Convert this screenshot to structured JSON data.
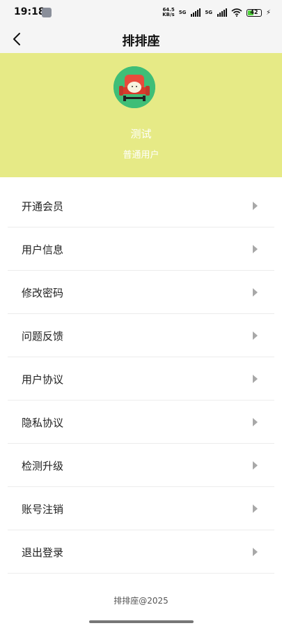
{
  "status_bar": {
    "time": "19:18",
    "net_speed_value": "64.5",
    "net_speed_unit": "KB/s",
    "signal_1_label": "5G",
    "signal_2_label": "5G",
    "battery_level": "42",
    "icons": [
      "wrench-icon",
      "signal-icon",
      "wifi-icon",
      "battery-icon",
      "charging-icon"
    ]
  },
  "nav": {
    "title": "排排座",
    "back_icon": "chevron-left-icon"
  },
  "profile": {
    "background_color": "#e6ea86",
    "name": "测试",
    "level": "普通用户",
    "avatar_icon": "seat-icon"
  },
  "menu": {
    "items": [
      {
        "label": "开通会员"
      },
      {
        "label": "用户信息"
      },
      {
        "label": "修改密码"
      },
      {
        "label": "问题反馈"
      },
      {
        "label": "用户协议"
      },
      {
        "label": "隐私协议"
      },
      {
        "label": "检测升级"
      },
      {
        "label": "账号注销"
      },
      {
        "label": "退出登录"
      }
    ]
  },
  "footer": {
    "copyright": "排排座@2025"
  }
}
